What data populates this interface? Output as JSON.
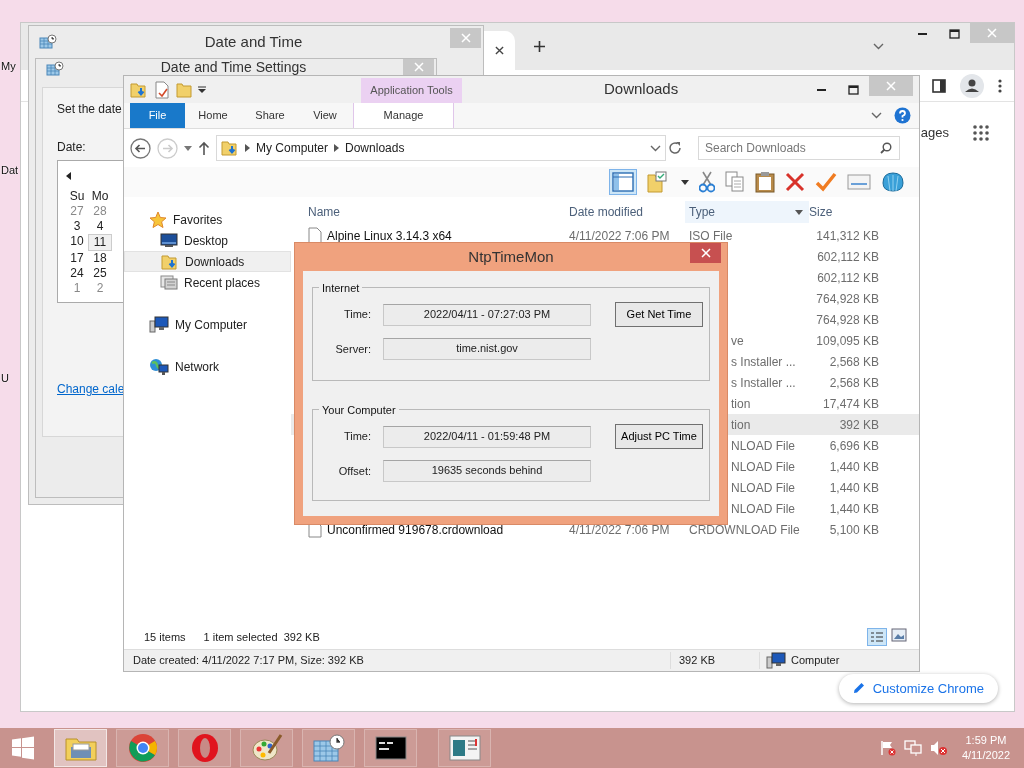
{
  "desktop_icons": [
    {
      "label": "My"
    },
    {
      "label": "Dat"
    },
    {
      "label": "U"
    }
  ],
  "chrome_window": {
    "partial_link": "ages",
    "customize_button": "Customize Chrome"
  },
  "date_time_window": {
    "title": "Date and Time"
  },
  "date_time_settings": {
    "title": "Date and Time Settings",
    "instruction": "Set the date",
    "date_label": "Date:",
    "calendar": {
      "weekdays": [
        "Su",
        "Mo"
      ],
      "weeks": [
        [
          {
            "day": "27",
            "muted": true,
            "selected": false
          },
          {
            "day": "28",
            "muted": true,
            "selected": false
          }
        ],
        [
          {
            "day": "3",
            "muted": false,
            "selected": false
          },
          {
            "day": "4",
            "muted": false,
            "selected": false
          }
        ],
        [
          {
            "day": "10",
            "muted": false,
            "selected": false
          },
          {
            "day": "11",
            "muted": false,
            "selected": true
          }
        ],
        [
          {
            "day": "17",
            "muted": false,
            "selected": false
          },
          {
            "day": "18",
            "muted": false,
            "selected": false
          }
        ],
        [
          {
            "day": "24",
            "muted": false,
            "selected": false
          },
          {
            "day": "25",
            "muted": false,
            "selected": false
          }
        ],
        [
          {
            "day": "1",
            "muted": true,
            "selected": false
          },
          {
            "day": "2",
            "muted": true,
            "selected": false
          }
        ]
      ]
    },
    "link": "Change cale"
  },
  "explorer": {
    "title": "Downloads",
    "context_tab": "Application Tools",
    "ribbon_tabs": [
      {
        "label": "File",
        "kind": "file"
      },
      {
        "label": "Home",
        "kind": "tab"
      },
      {
        "label": "Share",
        "kind": "tab"
      },
      {
        "label": "View",
        "kind": "tab"
      },
      {
        "label": "Manage",
        "kind": "context"
      }
    ],
    "breadcrumb": [
      "My Computer",
      "Downloads"
    ],
    "search": {
      "placeholder": "Search Downloads"
    },
    "nav": [
      {
        "label": "Favorites",
        "selected": false,
        "children": [
          {
            "label": "Desktop",
            "selected": false
          },
          {
            "label": "Downloads",
            "selected": true
          },
          {
            "label": "Recent places",
            "selected": false
          }
        ]
      },
      {
        "label": "My Computer",
        "selected": false
      },
      {
        "label": "Network",
        "selected": false
      }
    ],
    "columns": [
      "Name",
      "Date modified",
      "Type",
      "Size"
    ],
    "files": [
      {
        "kind": "full",
        "name": "Alpine Linux 3.14.3 x64",
        "date": "4/11/2022 7:06 PM",
        "type": "ISO File",
        "size": "141,312 KB",
        "selected": false
      },
      {
        "kind": "covered",
        "size": "602,112 KB",
        "selected": false
      },
      {
        "kind": "covered",
        "size": "602,112 KB",
        "selected": false
      },
      {
        "kind": "covered",
        "size": "764,928 KB",
        "selected": false
      },
      {
        "kind": "covered",
        "size": "764,928 KB",
        "selected": false
      },
      {
        "kind": "covered",
        "type": "ve",
        "size": "109,095 KB",
        "selected": false
      },
      {
        "kind": "covered",
        "type": "s Installer ...",
        "size": "2,568 KB",
        "selected": false
      },
      {
        "kind": "covered",
        "type": "s Installer ...",
        "size": "2,568 KB",
        "selected": false
      },
      {
        "kind": "covered",
        "type": "tion",
        "size": "17,474 KB",
        "selected": false
      },
      {
        "kind": "covered",
        "type": "tion",
        "size": "392 KB",
        "selected": true
      },
      {
        "kind": "covered",
        "type": "NLOAD File",
        "size": "6,696 KB",
        "selected": false
      },
      {
        "kind": "covered",
        "type": "NLOAD File",
        "size": "1,440 KB",
        "selected": false
      },
      {
        "kind": "covered",
        "type": "NLOAD File",
        "size": "1,440 KB",
        "selected": false
      },
      {
        "kind": "covered",
        "type": "NLOAD File",
        "size": "1,440 KB",
        "selected": false
      },
      {
        "kind": "full",
        "name": "Unconfirmed 919678.crdownload",
        "date": "4/11/2022 7:06 PM",
        "type": "CRDOWNLOAD File",
        "size": "5,100 KB",
        "selected": false
      }
    ],
    "status": {
      "count": "15 items",
      "selection": "1 item selected",
      "selection_size": "392 KB"
    },
    "details_bar": {
      "info": "Date created: 4/11/2022 7:17 PM, Size: 392 KB",
      "size": "392 KB",
      "location": "Computer"
    }
  },
  "ntp_dialog": {
    "title": "NtpTimeMon",
    "groups": [
      {
        "title": "Internet",
        "rows": [
          {
            "label": "Time:",
            "value": "2022/04/11 - 07:27:03 PM",
            "button": "Get Net Time"
          },
          {
            "label": "Server:",
            "value": "time.nist.gov"
          }
        ]
      },
      {
        "title": "Your Computer",
        "rows": [
          {
            "label": "Time:",
            "value": "2022/04/11 - 01:59:48 PM",
            "button": "Adjust PC Time"
          },
          {
            "label": "Offset:",
            "value": "19635 seconds behind"
          }
        ]
      }
    ]
  },
  "taskbar": {
    "apps": [
      {
        "kind": "explorer",
        "selected": true
      },
      {
        "kind": "chrome",
        "selected": false
      },
      {
        "kind": "opera",
        "selected": false
      },
      {
        "kind": "paint",
        "selected": false
      },
      {
        "kind": "calendar",
        "selected": false
      },
      {
        "kind": "console",
        "selected": false
      },
      {
        "kind": "viewer",
        "selected": false
      }
    ],
    "clock": {
      "time": "1:59 PM",
      "date": "4/11/2022"
    }
  }
}
